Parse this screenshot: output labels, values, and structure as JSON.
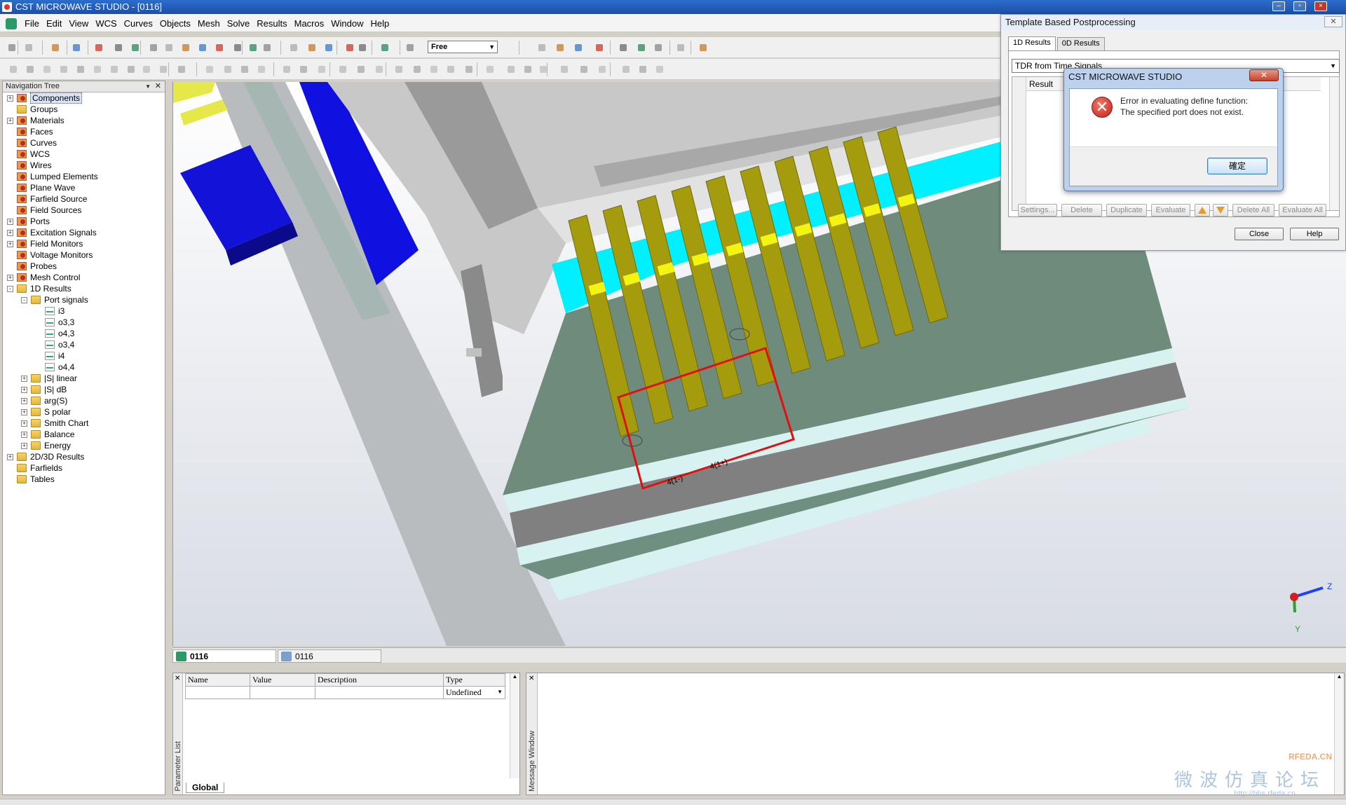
{
  "window": {
    "title": "CST MICROWAVE STUDIO - [0116]"
  },
  "menu": [
    "File",
    "Edit",
    "View",
    "WCS",
    "Curves",
    "Objects",
    "Mesh",
    "Solve",
    "Results",
    "Macros",
    "Window",
    "Help"
  ],
  "toolbar": {
    "mode_select": "Free"
  },
  "navtree": {
    "title": "Navigation Tree",
    "items": [
      {
        "label": "Components",
        "indent": 0,
        "expander": "+",
        "icon": "red",
        "selected": true
      },
      {
        "label": "Groups",
        "indent": 0,
        "expander": "",
        "icon": "folder"
      },
      {
        "label": "Materials",
        "indent": 0,
        "expander": "+",
        "icon": "red"
      },
      {
        "label": "Faces",
        "indent": 0,
        "expander": "",
        "icon": "red"
      },
      {
        "label": "Curves",
        "indent": 0,
        "expander": "",
        "icon": "red"
      },
      {
        "label": "WCS",
        "indent": 0,
        "expander": "",
        "icon": "red"
      },
      {
        "label": "Wires",
        "indent": 0,
        "expander": "",
        "icon": "red"
      },
      {
        "label": "Lumped Elements",
        "indent": 0,
        "expander": "",
        "icon": "red"
      },
      {
        "label": "Plane Wave",
        "indent": 0,
        "expander": "",
        "icon": "red"
      },
      {
        "label": "Farfield Source",
        "indent": 0,
        "expander": "",
        "icon": "red"
      },
      {
        "label": "Field Sources",
        "indent": 0,
        "expander": "",
        "icon": "red"
      },
      {
        "label": "Ports",
        "indent": 0,
        "expander": "+",
        "icon": "red"
      },
      {
        "label": "Excitation Signals",
        "indent": 0,
        "expander": "+",
        "icon": "red"
      },
      {
        "label": "Field Monitors",
        "indent": 0,
        "expander": "+",
        "icon": "red"
      },
      {
        "label": "Voltage Monitors",
        "indent": 0,
        "expander": "",
        "icon": "red"
      },
      {
        "label": "Probes",
        "indent": 0,
        "expander": "",
        "icon": "red"
      },
      {
        "label": "Mesh Control",
        "indent": 0,
        "expander": "+",
        "icon": "red"
      },
      {
        "label": "1D Results",
        "indent": 0,
        "expander": "-",
        "icon": "folder"
      },
      {
        "label": "Port signals",
        "indent": 1,
        "expander": "-",
        "icon": "folder"
      },
      {
        "label": "i3",
        "indent": 2,
        "expander": "",
        "icon": "sig"
      },
      {
        "label": "o3,3",
        "indent": 2,
        "expander": "",
        "icon": "sig"
      },
      {
        "label": "o4,3",
        "indent": 2,
        "expander": "",
        "icon": "sig"
      },
      {
        "label": "o3,4",
        "indent": 2,
        "expander": "",
        "icon": "sig"
      },
      {
        "label": "i4",
        "indent": 2,
        "expander": "",
        "icon": "sig"
      },
      {
        "label": "o4,4",
        "indent": 2,
        "expander": "",
        "icon": "sig"
      },
      {
        "label": "|S| linear",
        "indent": 1,
        "expander": "+",
        "icon": "folder"
      },
      {
        "label": "|S| dB",
        "indent": 1,
        "expander": "+",
        "icon": "folder"
      },
      {
        "label": "arg(S)",
        "indent": 1,
        "expander": "+",
        "icon": "folder"
      },
      {
        "label": "S polar",
        "indent": 1,
        "expander": "+",
        "icon": "folder"
      },
      {
        "label": "Smith Chart",
        "indent": 1,
        "expander": "+",
        "icon": "folder"
      },
      {
        "label": "Balance",
        "indent": 1,
        "expander": "+",
        "icon": "folder"
      },
      {
        "label": "Energy",
        "indent": 1,
        "expander": "+",
        "icon": "folder"
      },
      {
        "label": "2D/3D Results",
        "indent": 0,
        "expander": "+",
        "icon": "folder"
      },
      {
        "label": "Farfields",
        "indent": 0,
        "expander": "",
        "icon": "folder"
      },
      {
        "label": "Tables",
        "indent": 0,
        "expander": "",
        "icon": "folder"
      }
    ]
  },
  "viewport": {
    "port_label_left": "4(1-)",
    "port_label_right": "4(1+)",
    "axis_z": "Z",
    "axis_y": "Y"
  },
  "view_tabs": [
    "0116",
    "0116"
  ],
  "param_list": {
    "side_label": "Parameter List",
    "columns": [
      "Name",
      "Value",
      "Description",
      "Type"
    ],
    "row": {
      "type": "Undefined"
    },
    "tab": "Global"
  },
  "message_window": {
    "side_label": "Message Window"
  },
  "template_window": {
    "title": "Template Based Postprocessing",
    "tabs": [
      "1D Results",
      "0D Results"
    ],
    "combo_value": "TDR from Time Signals",
    "grid_header": "Result",
    "buttons": [
      "Settings...",
      "Delete",
      "Duplicate",
      "Evaluate",
      "Delete All",
      "Evaluate All"
    ],
    "close": "Close",
    "help": "Help"
  },
  "error_dialog": {
    "title": "CST MICROWAVE STUDIO",
    "line1": "Error in evaluating define function:",
    "line2": "The specified port does not exist.",
    "ok": "確定"
  },
  "watermark": {
    "brand": "RFEDA.CN",
    "text": "微波仿真论坛",
    "url": "http://bbs.rfeda.cn"
  }
}
